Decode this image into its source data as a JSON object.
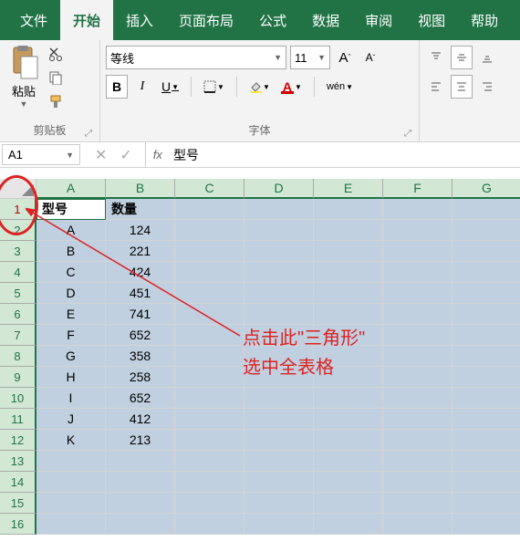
{
  "tabs": [
    "文件",
    "开始",
    "插入",
    "页面布局",
    "公式",
    "数据",
    "审阅",
    "视图",
    "帮助"
  ],
  "active_tab": 1,
  "ribbon": {
    "clipboard": {
      "label": "剪贴板",
      "paste": "粘贴"
    },
    "font": {
      "label": "字体",
      "name": "等线",
      "size": "11",
      "bold": "B",
      "italic": "I",
      "underline": "U",
      "wen": "wén"
    }
  },
  "namebox": "A1",
  "formula": "型号",
  "cols": [
    "A",
    "B",
    "C",
    "D",
    "E",
    "F",
    "G"
  ],
  "rows": [
    "1",
    "2",
    "3",
    "4",
    "5",
    "6",
    "7",
    "8",
    "9",
    "10",
    "11",
    "12",
    "13",
    "14",
    "15",
    "16"
  ],
  "headers": [
    "型号",
    "数量"
  ],
  "data": [
    [
      "A",
      "124"
    ],
    [
      "B",
      "221"
    ],
    [
      "C",
      "424"
    ],
    [
      "D",
      "451"
    ],
    [
      "E",
      "741"
    ],
    [
      "F",
      "652"
    ],
    [
      "G",
      "358"
    ],
    [
      "H",
      "258"
    ],
    [
      "I",
      "652"
    ],
    [
      "J",
      "412"
    ],
    [
      "K",
      "213"
    ]
  ],
  "annotation": {
    "line1": "点击此\"三角形\"",
    "line2": "选中全表格"
  },
  "chart_data": {
    "type": "table",
    "columns": [
      "型号",
      "数量"
    ],
    "rows": [
      [
        "A",
        124
      ],
      [
        "B",
        221
      ],
      [
        "C",
        424
      ],
      [
        "D",
        451
      ],
      [
        "E",
        741
      ],
      [
        "F",
        652
      ],
      [
        "G",
        358
      ],
      [
        "H",
        258
      ],
      [
        "I",
        652
      ],
      [
        "J",
        412
      ],
      [
        "K",
        213
      ]
    ]
  }
}
